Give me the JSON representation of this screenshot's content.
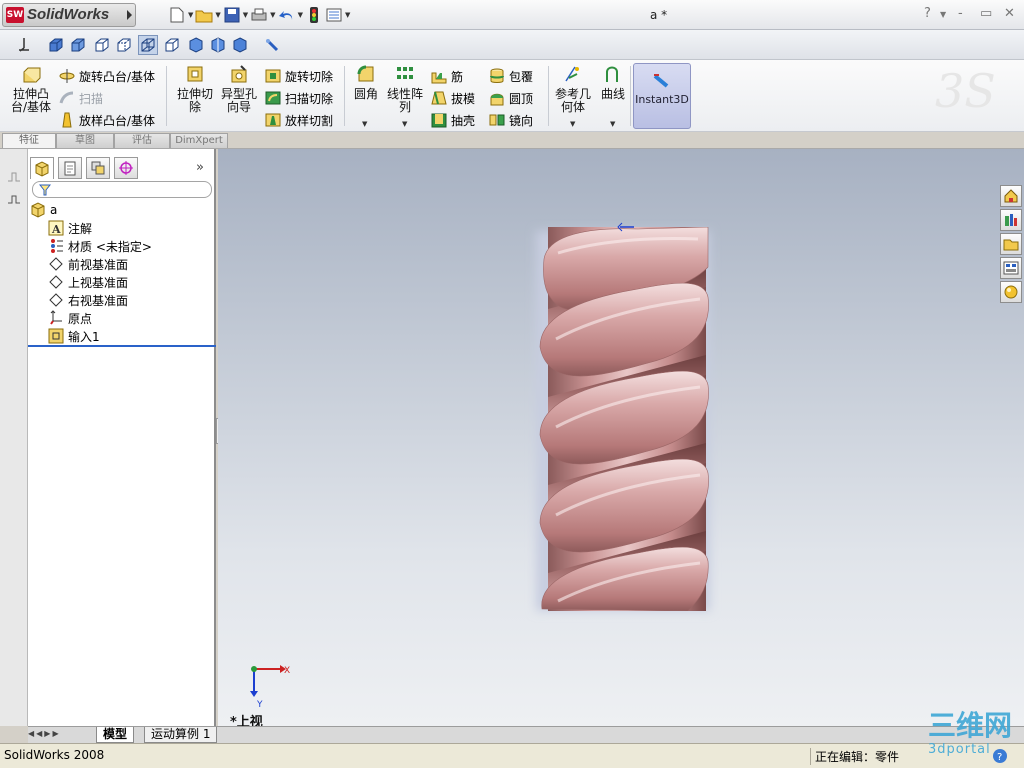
{
  "app": {
    "brand": "SolidWorks",
    "logo_badge": "SW",
    "document_title": "a *",
    "window_buttons": [
      "?",
      "-",
      "–",
      "▭"
    ]
  },
  "command_manager": {
    "extrude_boss": "拉伸凸\n台/基体",
    "revolve_boss": "旋转凸台/基体",
    "sweep": "扫描",
    "loft_boss": "放样凸台/基体",
    "extrude_cut": "拉伸切\n除",
    "hole_wizard": "异型孔\n向导",
    "revolve_cut": "旋转切除",
    "sweep_cut": "扫描切除",
    "loft_cut": "放样切割",
    "fillet": "圆角",
    "linear_pattern": "线性阵\n列",
    "rib": "筋",
    "draft": "拔模",
    "shell": "抽壳",
    "wrap": "包覆",
    "dome": "圆顶",
    "mirror": "镜向",
    "ref_geometry": "参考几\n何体",
    "curves": "曲线",
    "instant3d": "Instant3D"
  },
  "tabs": [
    "特征",
    "草图",
    "评估",
    "DimXpert"
  ],
  "feature_tree": {
    "root": "a",
    "items": [
      {
        "label": "注解",
        "icon": "annotation-icon"
      },
      {
        "label": "材质 <未指定>",
        "icon": "material-icon"
      },
      {
        "label": "前视基准面",
        "icon": "plane-icon"
      },
      {
        "label": "上视基准面",
        "icon": "plane-icon"
      },
      {
        "label": "右视基准面",
        "icon": "plane-icon"
      },
      {
        "label": "原点",
        "icon": "origin-icon"
      },
      {
        "label": "输入1",
        "icon": "imported-body-icon"
      }
    ],
    "collapse": "»"
  },
  "viewport": {
    "view_label": "*上视",
    "triad_x": "X",
    "triad_y": "Y",
    "part_color": "#c98e8e"
  },
  "bottom_tabs": [
    "模型",
    "运动算例 1"
  ],
  "status": {
    "app_version": "SolidWorks 2008",
    "editing": "正在编辑：零件"
  },
  "watermark": {
    "text": "三维网",
    "url": "3dportal"
  }
}
